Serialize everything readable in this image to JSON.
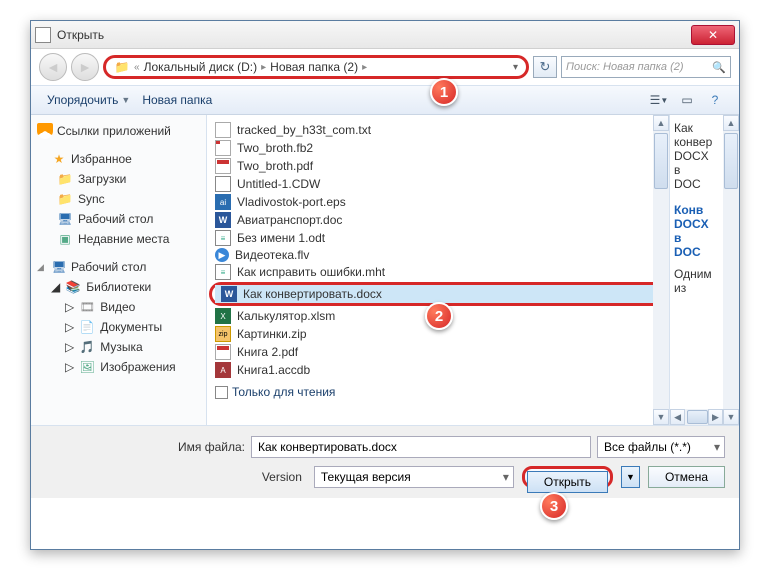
{
  "titlebar": {
    "title": "Открыть"
  },
  "breadcrumb": {
    "chev": "«",
    "seg1": "Локальный диск (D:)",
    "seg2": "Новая папка (2)"
  },
  "search": {
    "placeholder": "Поиск: Новая папка (2)"
  },
  "toolbar": {
    "organize": "Упорядочить",
    "newfolder": "Новая папка"
  },
  "sidebar": {
    "appLinks": "Ссылки приложений",
    "fav": "Избранное",
    "downloads": "Загрузки",
    "sync": "Sync",
    "desktop": "Рабочий стол",
    "recent": "Недавние места",
    "desk2": "Рабочий стол",
    "libs": "Библиотеки",
    "video": "Видео",
    "docs": "Документы",
    "music": "Музыка",
    "images": "Изображения"
  },
  "files": {
    "f0": "tracked_by_h33t_com.txt",
    "f1": "Two_broth.fb2",
    "f2": "Two_broth.pdf",
    "f3": "Untitled-1.CDW",
    "f4": "Vladivostok-port.eps",
    "f5": "Авиатранспорт.doc",
    "f6": "Без имени 1.odt",
    "f7": "Видеотека.flv",
    "f8": "Как исправить ошибки.mht",
    "f9": "Как конвертировать.docx",
    "f10": "Калькулятор.xlsm",
    "f11": "Картинки.zip",
    "f12": "Книга 2.pdf",
    "f13": "Книга1.accdb"
  },
  "readonly_label": "Только для чтения",
  "preview": {
    "l1": "Как",
    "l2": "конвер",
    "l3": "DOCX",
    "l4": "в",
    "l5": "DOC",
    "b1": "Конв",
    "b2": "DOCX",
    "b3": "в",
    "b4": "DOC",
    "l6": "Одним",
    "l7": "из"
  },
  "bottom": {
    "filename_label": "Имя файла:",
    "filename_value": "Как конвертировать.docx",
    "filter": "Все файлы (*.*)",
    "version_label": "Version",
    "version_value": "Текущая версия",
    "open": "Открыть",
    "cancel": "Отмена"
  },
  "badges": {
    "b1": "1",
    "b2": "2",
    "b3": "3"
  }
}
